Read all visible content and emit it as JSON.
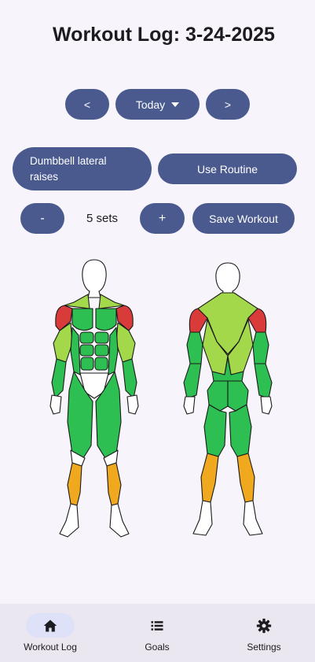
{
  "header": {
    "title": "Workout Log: 3-24-2025"
  },
  "date_nav": {
    "prev_label": "<",
    "date_label": "Today",
    "next_label": ">"
  },
  "exercise": {
    "name": "Dumbbell lateral raises",
    "routine_label": "Use Routine"
  },
  "sets": {
    "minus_label": "-",
    "display": "5 sets",
    "plus_label": "+",
    "save_label": "Save Workout"
  },
  "colors": {
    "accent": "#4a5a8f",
    "primary_muscle": "#d93a3a",
    "secondary_muscle": "#a2d84a",
    "worked_muscle": "#2dbf52",
    "calf_muscle": "#f0a81e"
  },
  "nav": {
    "items": [
      {
        "label": "Workout Log",
        "icon": "home-icon",
        "active": true
      },
      {
        "label": "Goals",
        "icon": "list-icon",
        "active": false
      },
      {
        "label": "Settings",
        "icon": "gear-icon",
        "active": false
      }
    ]
  }
}
